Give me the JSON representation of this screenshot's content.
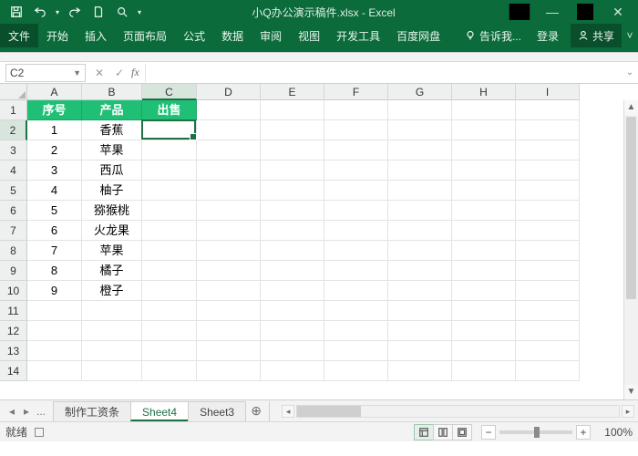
{
  "title": "小Q办公演示稿件.xlsx - Excel",
  "qat_icons": [
    "save-icon",
    "undo-icon",
    "redo-icon",
    "new-icon",
    "print-preview-icon"
  ],
  "window_controls": [
    "minimize",
    "maximize",
    "close"
  ],
  "ribbon_tabs": [
    "文件",
    "开始",
    "插入",
    "页面布局",
    "公式",
    "数据",
    "审阅",
    "视图",
    "开发工具",
    "百度网盘"
  ],
  "tell_me": "告诉我...",
  "login": "登录",
  "share": "共享",
  "name_box": "C2",
  "fx_label": "fx",
  "formula_value": "",
  "columns": {
    "labels": [
      "A",
      "B",
      "C",
      "D",
      "E",
      "F",
      "G",
      "H",
      "I"
    ],
    "widths": [
      60,
      66,
      60,
      70,
      70,
      70,
      70,
      70,
      70
    ],
    "selected_index": 2
  },
  "row_count": 14,
  "selected_row": 2,
  "selected_col": 2,
  "table": {
    "header": [
      "序号",
      "产品",
      "出售"
    ],
    "rows": [
      [
        "1",
        "香蕉",
        ""
      ],
      [
        "2",
        "苹果",
        ""
      ],
      [
        "3",
        "西瓜",
        ""
      ],
      [
        "4",
        "柚子",
        ""
      ],
      [
        "5",
        "猕猴桃",
        ""
      ],
      [
        "6",
        "火龙果",
        ""
      ],
      [
        "7",
        "苹果",
        ""
      ],
      [
        "8",
        "橘子",
        ""
      ],
      [
        "9",
        "橙子",
        ""
      ]
    ]
  },
  "sheet_tabs": {
    "tabs": [
      "制作工资条",
      "Sheet4",
      "Sheet3"
    ],
    "active_index": 1,
    "ellipsis": "..."
  },
  "status": {
    "ready": "就绪",
    "zoom": "100%"
  }
}
